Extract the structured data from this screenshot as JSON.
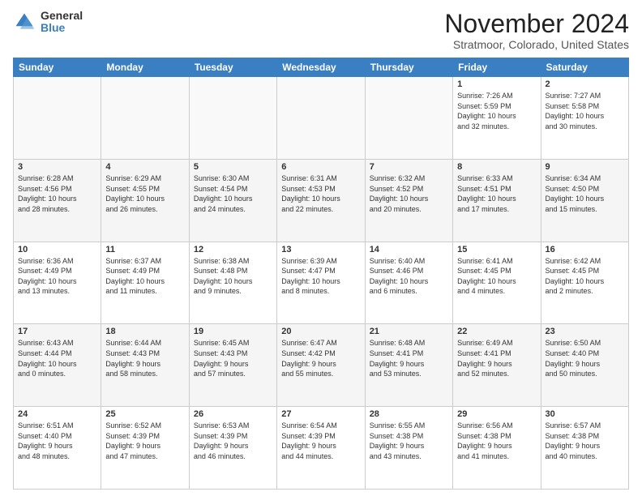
{
  "header": {
    "logo_general": "General",
    "logo_blue": "Blue",
    "month_title": "November 2024",
    "location": "Stratmoor, Colorado, United States"
  },
  "days_of_week": [
    "Sunday",
    "Monday",
    "Tuesday",
    "Wednesday",
    "Thursday",
    "Friday",
    "Saturday"
  ],
  "weeks": [
    [
      {
        "day": "",
        "info": ""
      },
      {
        "day": "",
        "info": ""
      },
      {
        "day": "",
        "info": ""
      },
      {
        "day": "",
        "info": ""
      },
      {
        "day": "",
        "info": ""
      },
      {
        "day": "1",
        "info": "Sunrise: 7:26 AM\nSunset: 5:59 PM\nDaylight: 10 hours\nand 32 minutes."
      },
      {
        "day": "2",
        "info": "Sunrise: 7:27 AM\nSunset: 5:58 PM\nDaylight: 10 hours\nand 30 minutes."
      }
    ],
    [
      {
        "day": "3",
        "info": "Sunrise: 6:28 AM\nSunset: 4:56 PM\nDaylight: 10 hours\nand 28 minutes."
      },
      {
        "day": "4",
        "info": "Sunrise: 6:29 AM\nSunset: 4:55 PM\nDaylight: 10 hours\nand 26 minutes."
      },
      {
        "day": "5",
        "info": "Sunrise: 6:30 AM\nSunset: 4:54 PM\nDaylight: 10 hours\nand 24 minutes."
      },
      {
        "day": "6",
        "info": "Sunrise: 6:31 AM\nSunset: 4:53 PM\nDaylight: 10 hours\nand 22 minutes."
      },
      {
        "day": "7",
        "info": "Sunrise: 6:32 AM\nSunset: 4:52 PM\nDaylight: 10 hours\nand 20 minutes."
      },
      {
        "day": "8",
        "info": "Sunrise: 6:33 AM\nSunset: 4:51 PM\nDaylight: 10 hours\nand 17 minutes."
      },
      {
        "day": "9",
        "info": "Sunrise: 6:34 AM\nSunset: 4:50 PM\nDaylight: 10 hours\nand 15 minutes."
      }
    ],
    [
      {
        "day": "10",
        "info": "Sunrise: 6:36 AM\nSunset: 4:49 PM\nDaylight: 10 hours\nand 13 minutes."
      },
      {
        "day": "11",
        "info": "Sunrise: 6:37 AM\nSunset: 4:49 PM\nDaylight: 10 hours\nand 11 minutes."
      },
      {
        "day": "12",
        "info": "Sunrise: 6:38 AM\nSunset: 4:48 PM\nDaylight: 10 hours\nand 9 minutes."
      },
      {
        "day": "13",
        "info": "Sunrise: 6:39 AM\nSunset: 4:47 PM\nDaylight: 10 hours\nand 8 minutes."
      },
      {
        "day": "14",
        "info": "Sunrise: 6:40 AM\nSunset: 4:46 PM\nDaylight: 10 hours\nand 6 minutes."
      },
      {
        "day": "15",
        "info": "Sunrise: 6:41 AM\nSunset: 4:45 PM\nDaylight: 10 hours\nand 4 minutes."
      },
      {
        "day": "16",
        "info": "Sunrise: 6:42 AM\nSunset: 4:45 PM\nDaylight: 10 hours\nand 2 minutes."
      }
    ],
    [
      {
        "day": "17",
        "info": "Sunrise: 6:43 AM\nSunset: 4:44 PM\nDaylight: 10 hours\nand 0 minutes."
      },
      {
        "day": "18",
        "info": "Sunrise: 6:44 AM\nSunset: 4:43 PM\nDaylight: 9 hours\nand 58 minutes."
      },
      {
        "day": "19",
        "info": "Sunrise: 6:45 AM\nSunset: 4:43 PM\nDaylight: 9 hours\nand 57 minutes."
      },
      {
        "day": "20",
        "info": "Sunrise: 6:47 AM\nSunset: 4:42 PM\nDaylight: 9 hours\nand 55 minutes."
      },
      {
        "day": "21",
        "info": "Sunrise: 6:48 AM\nSunset: 4:41 PM\nDaylight: 9 hours\nand 53 minutes."
      },
      {
        "day": "22",
        "info": "Sunrise: 6:49 AM\nSunset: 4:41 PM\nDaylight: 9 hours\nand 52 minutes."
      },
      {
        "day": "23",
        "info": "Sunrise: 6:50 AM\nSunset: 4:40 PM\nDaylight: 9 hours\nand 50 minutes."
      }
    ],
    [
      {
        "day": "24",
        "info": "Sunrise: 6:51 AM\nSunset: 4:40 PM\nDaylight: 9 hours\nand 48 minutes."
      },
      {
        "day": "25",
        "info": "Sunrise: 6:52 AM\nSunset: 4:39 PM\nDaylight: 9 hours\nand 47 minutes."
      },
      {
        "day": "26",
        "info": "Sunrise: 6:53 AM\nSunset: 4:39 PM\nDaylight: 9 hours\nand 46 minutes."
      },
      {
        "day": "27",
        "info": "Sunrise: 6:54 AM\nSunset: 4:39 PM\nDaylight: 9 hours\nand 44 minutes."
      },
      {
        "day": "28",
        "info": "Sunrise: 6:55 AM\nSunset: 4:38 PM\nDaylight: 9 hours\nand 43 minutes."
      },
      {
        "day": "29",
        "info": "Sunrise: 6:56 AM\nSunset: 4:38 PM\nDaylight: 9 hours\nand 41 minutes."
      },
      {
        "day": "30",
        "info": "Sunrise: 6:57 AM\nSunset: 4:38 PM\nDaylight: 9 hours\nand 40 minutes."
      }
    ]
  ]
}
